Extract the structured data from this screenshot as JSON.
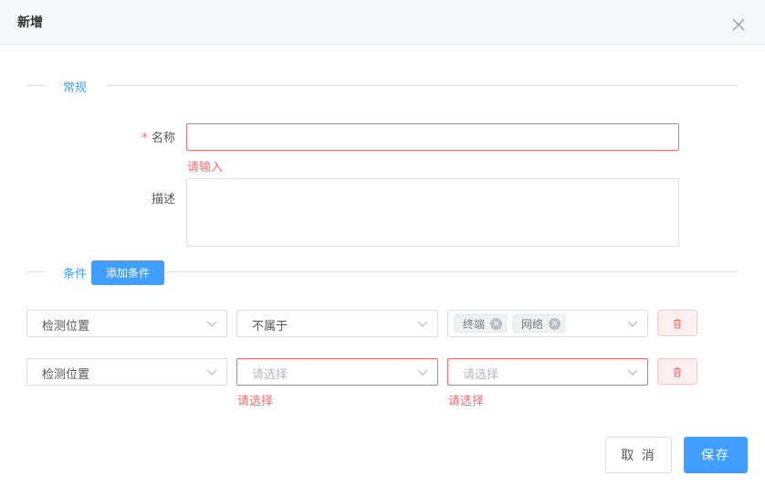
{
  "dialog": {
    "title": "新增"
  },
  "sections": {
    "general": "常规",
    "conditions": "条件"
  },
  "form": {
    "name_label": "名称",
    "name_required": "*",
    "name_error": "请输入",
    "desc_label": "描述"
  },
  "add_condition_label": "添加条件",
  "conditions": [
    {
      "field": "检测位置",
      "operator": "不属于",
      "values": [
        "终端",
        "网络"
      ]
    },
    {
      "field": "检测位置",
      "operator_placeholder": "请选择",
      "value_placeholder": "请选择",
      "operator_error": "请选择",
      "value_error": "请选择"
    }
  ],
  "footer": {
    "cancel": "取 消",
    "save": "保存"
  },
  "colors": {
    "primary": "#409eff",
    "danger": "#f56c6c",
    "header_bg": "#f7f8fa"
  },
  "icons": {
    "close": "close-icon",
    "chevron": "chevron-down-icon",
    "delete": "trash-icon",
    "tag_remove": "circle-x-icon"
  }
}
